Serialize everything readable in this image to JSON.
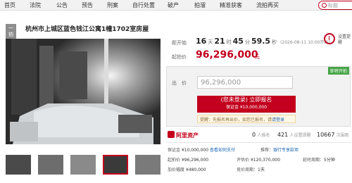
{
  "nav": {
    "items": [
      "首页",
      "法院",
      "公告",
      "预告",
      "刑案",
      "自行处置",
      "破产",
      "拍溜",
      "精准获客",
      "流拍再买"
    ],
    "search_placeholder": "标题"
  },
  "lot": {
    "tag": "一拍",
    "title": "杭州市上城区蓝色钱江公寓1幢1702室房屋"
  },
  "countdown": {
    "label": "距开始",
    "days": "16",
    "days_unit": "天",
    "hours": "21",
    "hours_unit": "时",
    "minutes": "45",
    "minutes_unit": "分",
    "seconds": "59.5",
    "seconds_unit": "秒",
    "date_note": "(2026-08-11 10:00开始)"
  },
  "reminder": {
    "label": "设置提醒"
  },
  "start_price": {
    "label": "起拍价",
    "value": "96,296,000",
    "unit": "元"
  },
  "bid": {
    "status": "即将开拍",
    "label": "出　价",
    "value": "96,296,000",
    "signup_line1": "(您未登录) 立即报名",
    "signup_line2": "保证金 ¥10,000,000",
    "tip_prefix": "提醒：先报名再出价，如您已报名，请",
    "tip_link": "请登录"
  },
  "stats": {
    "logo": "阿里资产",
    "signups": "0",
    "signups_label": "人报名",
    "reminders": "421",
    "reminders_label": "人设置提醒",
    "views": "10667",
    "views_label": "次围观"
  },
  "info": {
    "deposit_label": "保证金",
    "deposit_value": "¥10,000,000",
    "deposit_link": "查看如何支付",
    "recommend_label": "推荐：",
    "recommend_link": "银行专享款项",
    "start_label": "起拍价",
    "start_value": "¥96,296,000",
    "eval_label": "评估价",
    "eval_value": "¥120,370,000",
    "delay_label": "延时周期：",
    "delay_value": "5分钟",
    "increment_label": "加价幅度",
    "increment_value": "¥480,000",
    "cycle_label": "竞价周期：",
    "cycle_value": "1天"
  }
}
